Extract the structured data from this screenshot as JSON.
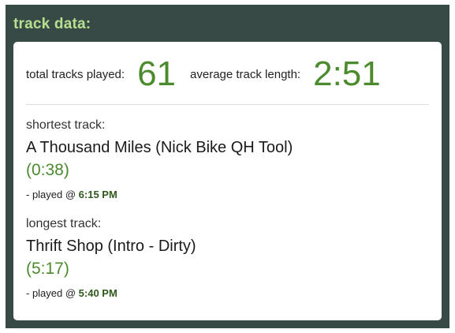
{
  "panel": {
    "title": "track data:"
  },
  "stats": {
    "total_label": "total tracks played:",
    "total_value": "61",
    "avg_label": "average track length:",
    "avg_value": "2:51"
  },
  "shortest": {
    "heading": "shortest track:",
    "name": "A Thousand Miles (Nick Bike QH Tool)",
    "duration": "(0:38)",
    "played_prefix": "- played @ ",
    "played_time": "6:15 PM"
  },
  "longest": {
    "heading": "longest track:",
    "name": "Thrift Shop (Intro - Dirty)",
    "duration": "(5:17)",
    "played_prefix": "- played @ ",
    "played_time": "5:40 PM"
  },
  "colors": {
    "panel_bg": "#384a46",
    "title": "#b6e08f",
    "accent_green": "#4b8a2d",
    "time_green": "#2f5a1b"
  }
}
